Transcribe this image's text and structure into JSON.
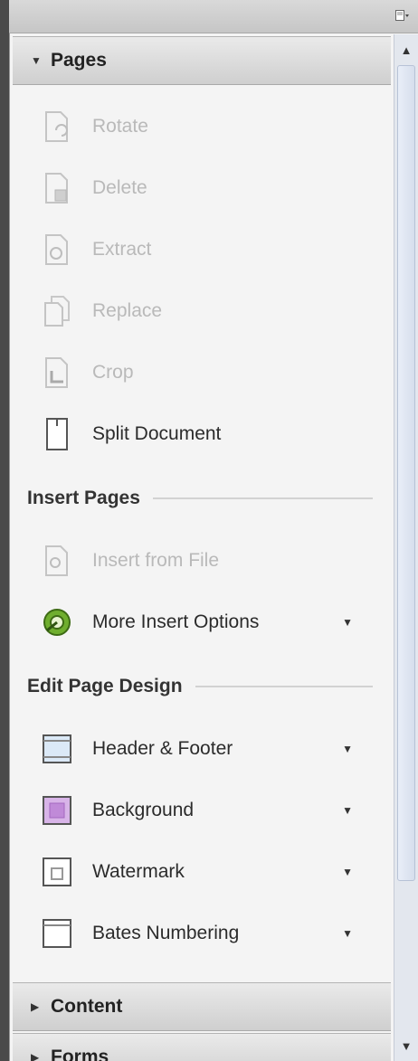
{
  "panel": {
    "options_icon": "panel-options-icon",
    "sections": [
      {
        "label": "Pages",
        "state": "expanded"
      },
      {
        "label": "Content",
        "state": "collapsed"
      },
      {
        "label": "Forms",
        "state": "collapsed"
      }
    ]
  },
  "pages_items": [
    {
      "label": "Rotate",
      "enabled": false,
      "icon": "rotate-page-icon"
    },
    {
      "label": "Delete",
      "enabled": false,
      "icon": "delete-page-icon"
    },
    {
      "label": "Extract",
      "enabled": false,
      "icon": "extract-page-icon"
    },
    {
      "label": "Replace",
      "enabled": false,
      "icon": "replace-page-icon"
    },
    {
      "label": "Crop",
      "enabled": false,
      "icon": "crop-page-icon"
    },
    {
      "label": "Split Document",
      "enabled": true,
      "icon": "split-document-icon"
    }
  ],
  "insert_pages": {
    "title": "Insert Pages",
    "items": [
      {
        "label": "Insert from File",
        "enabled": false,
        "icon": "insert-from-file-icon"
      },
      {
        "label": "More Insert Options",
        "enabled": true,
        "dropdown": true,
        "icon": "more-insert-options-icon"
      }
    ]
  },
  "edit_page_design": {
    "title": "Edit Page Design",
    "items": [
      {
        "label": "Header & Footer",
        "dropdown": true,
        "icon": "header-footer-icon"
      },
      {
        "label": "Background",
        "dropdown": true,
        "icon": "background-icon",
        "color": "#c08ad8"
      },
      {
        "label": "Watermark",
        "dropdown": true,
        "icon": "watermark-icon"
      },
      {
        "label": "Bates Numbering",
        "dropdown": true,
        "icon": "bates-numbering-icon"
      }
    ]
  },
  "scrollbar": {
    "up_icon": "scroll-up-icon",
    "down_icon": "scroll-down-icon"
  }
}
